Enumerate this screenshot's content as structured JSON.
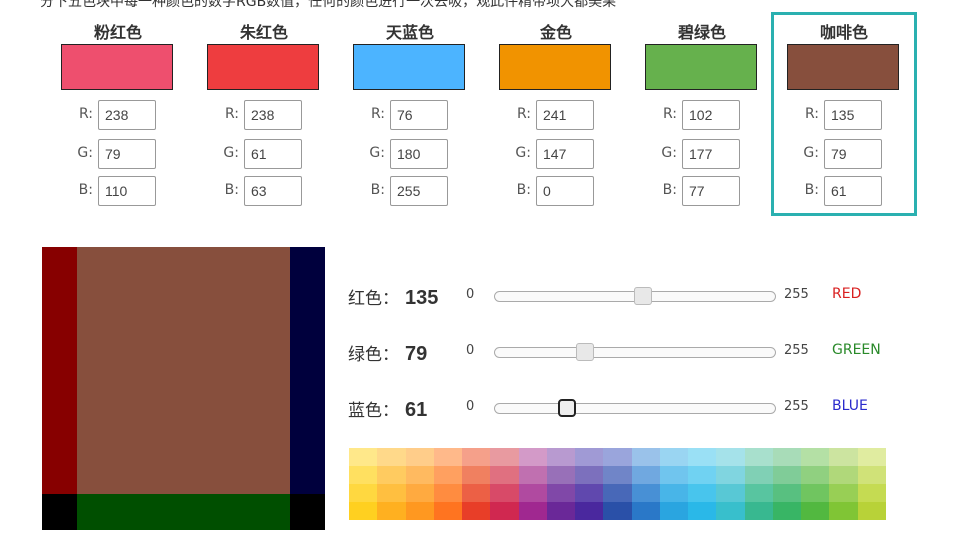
{
  "intro_text": "分下五色块中每一种颜色的数字RGB数值，任何的颜色进行一次去吸，观此件精带项大都美果",
  "labels": {
    "r": "R:",
    "g": "G:",
    "b": "B:",
    "min": "0",
    "max": "255"
  },
  "swatches": [
    {
      "name": "粉红色",
      "r": "238",
      "g": "79",
      "b": "110",
      "hex": "#ee4f6e",
      "selected": false
    },
    {
      "name": "朱红色",
      "r": "238",
      "g": "61",
      "b": "63",
      "hex": "#ee3d3f",
      "selected": false
    },
    {
      "name": "天蓝色",
      "r": "76",
      "g": "180",
      "b": "255",
      "hex": "#4cb4ff",
      "selected": false
    },
    {
      "name": "金色",
      "r": "241",
      "g": "147",
      "b": "0",
      "hex": "#f19300",
      "selected": false
    },
    {
      "name": "碧绿色",
      "r": "102",
      "g": "177",
      "b": "77",
      "hex": "#66b14d",
      "selected": false
    },
    {
      "name": "咖啡色",
      "r": "135",
      "g": "79",
      "b": "61",
      "hex": "#874f3d",
      "selected": true
    }
  ],
  "preview_colors": {
    "main": "#874f3d",
    "red": "#870000",
    "green": "#004f00",
    "blue": "#00003d",
    "corner": "#000000"
  },
  "sliders": [
    {
      "label": "红色：",
      "value": 135,
      "value_text": "135",
      "name": "RED",
      "name_color": "#d92020"
    },
    {
      "label": "绿色：",
      "value": 79,
      "value_text": "79",
      "name": "GREEN",
      "name_color": "#2a8a2a"
    },
    {
      "label": "蓝色：",
      "value": 61,
      "value_text": "61",
      "name": "BLUE",
      "name_color": "#2a2acc"
    }
  ],
  "palette": [
    [
      "#ffe88a",
      "#ffd98a",
      "#ffcd8a",
      "#ffb98a",
      "#f5a08a",
      "#e89aa0",
      "#d39ac8",
      "#b89ad0",
      "#a09ad5",
      "#9aa5dc",
      "#9ac2ea",
      "#9ad5f2",
      "#9ae0f5",
      "#a5e2ea",
      "#a8e0cd",
      "#a8dcb8",
      "#b4e0a5",
      "#cce4a0",
      "#e0eca0"
    ],
    [
      "#ffe060",
      "#ffcb60",
      "#ffba60",
      "#ffa060",
      "#f08060",
      "#e07080",
      "#c070b0",
      "#9870b8",
      "#7c70bd",
      "#7085c8",
      "#70a8e0",
      "#70c5ee",
      "#70d2f2",
      "#80d5e0",
      "#80d0b5",
      "#80cc98",
      "#90d080",
      "#b0d87a",
      "#d0e278"
    ],
    [
      "#ffd840",
      "#ffbf40",
      "#ffaa40",
      "#ff8c40",
      "#ec6045",
      "#d84a68",
      "#b04aa0",
      "#8048a8",
      "#6048ae",
      "#4868b8",
      "#4890d5",
      "#48b5e8",
      "#48c5ed",
      "#58c8d5",
      "#58c5a0",
      "#58c080",
      "#70c560",
      "#98cf55",
      "#c5db52"
    ],
    [
      "#ffd020",
      "#ffb020",
      "#ff9820",
      "#ff7420",
      "#e83e28",
      "#d02850",
      "#a02890",
      "#6a2898",
      "#4a289e",
      "#2a50a8",
      "#2a78c8",
      "#2aa5e0",
      "#2ab8e8",
      "#38bfcc",
      "#38b890",
      "#38b565",
      "#52b840",
      "#80c535",
      "#b8d238"
    ]
  ]
}
